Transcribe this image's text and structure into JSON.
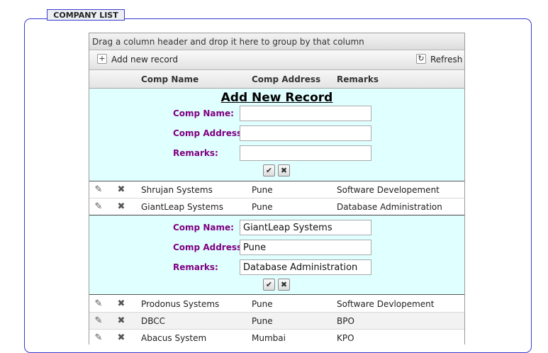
{
  "panel": {
    "title": "COMPANY LIST"
  },
  "grid": {
    "group_hint": "Drag a column header and drop it here to group by that column",
    "toolbar": {
      "add_label": "Add new record",
      "refresh_label": "Refresh",
      "add_icon": "plus-icon",
      "refresh_icon": "refresh-icon"
    },
    "columns": [
      "Comp Name",
      "Comp Address",
      "Remarks"
    ],
    "insert_form": {
      "title": "Add New Record",
      "fields": [
        {
          "label": "Comp Name:",
          "value": ""
        },
        {
          "label": "Comp Address:",
          "value": ""
        },
        {
          "label": "Remarks:",
          "value": ""
        }
      ]
    },
    "rows_top": [
      {
        "name": "Shrujan Systems",
        "address": "Pune",
        "remarks": "Software Developement"
      },
      {
        "name": "GiantLeap Systems",
        "address": "Pune",
        "remarks": "Database Administration"
      }
    ],
    "edit_form": {
      "fields": [
        {
          "label": "Comp Name:",
          "value": "GiantLeap Systems"
        },
        {
          "label": "Comp Address:",
          "value": "Pune"
        },
        {
          "label": "Remarks:",
          "value": "Database Administration"
        }
      ]
    },
    "rows_bottom": [
      {
        "name": "Prodonus Systems",
        "address": "Pune",
        "remarks": "Software Devlopement"
      },
      {
        "name": "DBCC",
        "address": "Pune",
        "remarks": "BPO"
      },
      {
        "name": "Abacus System",
        "address": "Mumbai",
        "remarks": "KPO"
      }
    ],
    "icons": {
      "edit": "pencil-icon",
      "delete": "delete-x-icon",
      "confirm": "checkmark-icon",
      "cancel": "cancel-x-icon"
    }
  }
}
